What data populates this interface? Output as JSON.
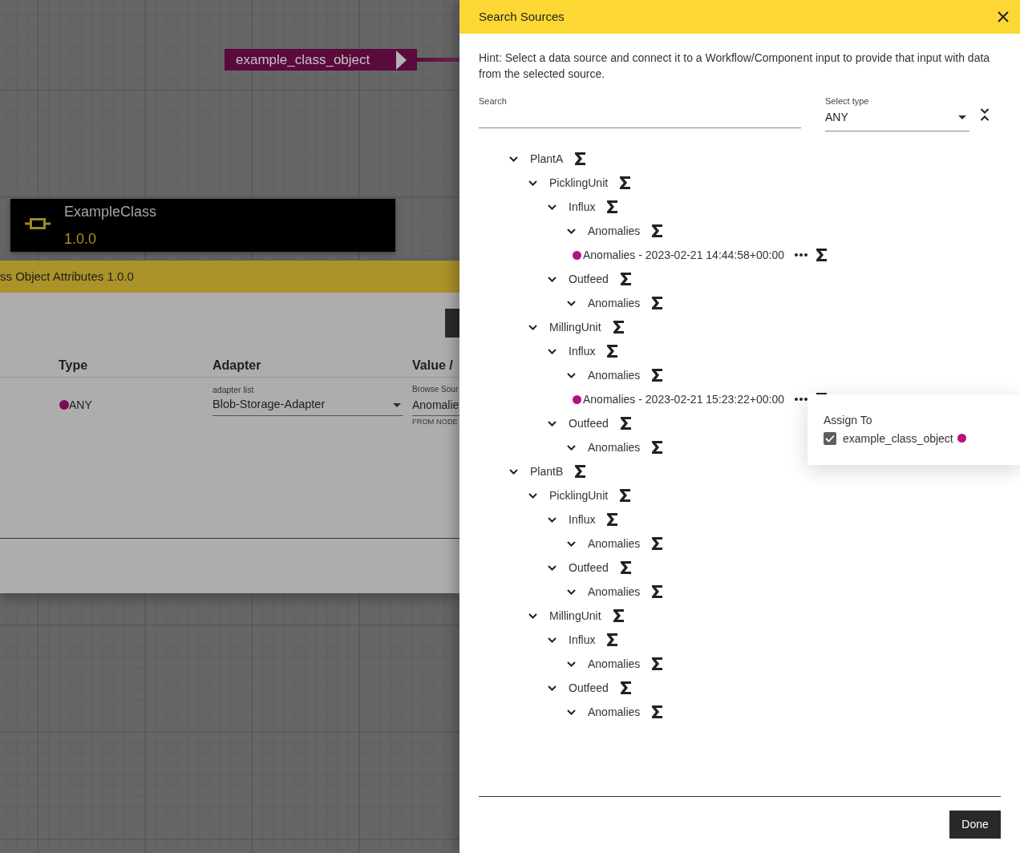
{
  "canvas": {
    "port": {
      "label": "example_class_object"
    },
    "node": {
      "title": "ExampleClass",
      "version": "1.0.0"
    }
  },
  "attributes_panel": {
    "title": "ss Object Attributes 1.0.0",
    "table": {
      "columns": [
        "Type",
        "Adapter",
        "Value /"
      ],
      "rows": [
        {
          "type": {
            "label": "ANY",
            "color": "#7b0c58"
          },
          "adapter": {
            "label": "adapter list",
            "value": "Blob-Storage-Adapter"
          },
          "value": {
            "label": "Browse Sour",
            "value": "Anomalie",
            "helper": "FROM NODE"
          }
        }
      ]
    }
  },
  "drawer": {
    "title": "Search Sources",
    "hint": "Hint: Select a data source and connect it to a Workflow/Component input to provide that input with data from the selected source.",
    "search": {
      "label": "Search"
    },
    "type_select": {
      "label": "Select type",
      "value": "ANY"
    },
    "tree": [
      {
        "label": "PlantA",
        "kind": "folder",
        "expanded": true,
        "children": [
          {
            "label": "PicklingUnit",
            "kind": "folder",
            "expanded": true,
            "children": [
              {
                "label": "Influx",
                "kind": "folder",
                "expanded": true,
                "children": [
                  {
                    "label": "Anomalies",
                    "kind": "folder",
                    "expanded": true,
                    "children": [
                      {
                        "label": "Anomalies - 2023-02-21 14:44:58+00:00",
                        "kind": "source",
                        "color": "#b5117f",
                        "menu_open": false
                      }
                    ]
                  }
                ]
              },
              {
                "label": "Outfeed",
                "kind": "folder",
                "expanded": true,
                "children": [
                  {
                    "label": "Anomalies",
                    "kind": "folder",
                    "expanded": true
                  }
                ]
              }
            ]
          },
          {
            "label": "MillingUnit",
            "kind": "folder",
            "expanded": true,
            "children": [
              {
                "label": "Influx",
                "kind": "folder",
                "expanded": true,
                "children": [
                  {
                    "label": "Anomalies",
                    "kind": "folder",
                    "expanded": true,
                    "children": [
                      {
                        "label": "Anomalies - 2023-02-21 15:23:22+00:00",
                        "kind": "source",
                        "color": "#b5117f",
                        "menu_open": true
                      }
                    ]
                  }
                ]
              },
              {
                "label": "Outfeed",
                "kind": "folder",
                "expanded": true,
                "children": [
                  {
                    "label": "Anomalies",
                    "kind": "folder",
                    "expanded": true
                  }
                ]
              }
            ]
          }
        ]
      },
      {
        "label": "PlantB",
        "kind": "folder",
        "expanded": true,
        "children": [
          {
            "label": "PicklingUnit",
            "kind": "folder",
            "expanded": true,
            "children": [
              {
                "label": "Influx",
                "kind": "folder",
                "expanded": true,
                "children": [
                  {
                    "label": "Anomalies",
                    "kind": "folder",
                    "expanded": true
                  }
                ]
              },
              {
                "label": "Outfeed",
                "kind": "folder",
                "expanded": true,
                "children": [
                  {
                    "label": "Anomalies",
                    "kind": "folder",
                    "expanded": true
                  }
                ]
              }
            ]
          },
          {
            "label": "MillingUnit",
            "kind": "folder",
            "expanded": true,
            "children": [
              {
                "label": "Influx",
                "kind": "folder",
                "expanded": true,
                "children": [
                  {
                    "label": "Anomalies",
                    "kind": "folder",
                    "expanded": true
                  }
                ]
              },
              {
                "label": "Outfeed",
                "kind": "folder",
                "expanded": true,
                "children": [
                  {
                    "label": "Anomalies",
                    "kind": "folder",
                    "expanded": true
                  }
                ]
              }
            ]
          }
        ]
      }
    ],
    "assign_menu": {
      "title": "Assign To",
      "options": [
        {
          "label": "example_class_object",
          "checked": true,
          "color": "#b5117f"
        }
      ]
    },
    "buttons": [
      "Done"
    ]
  }
}
